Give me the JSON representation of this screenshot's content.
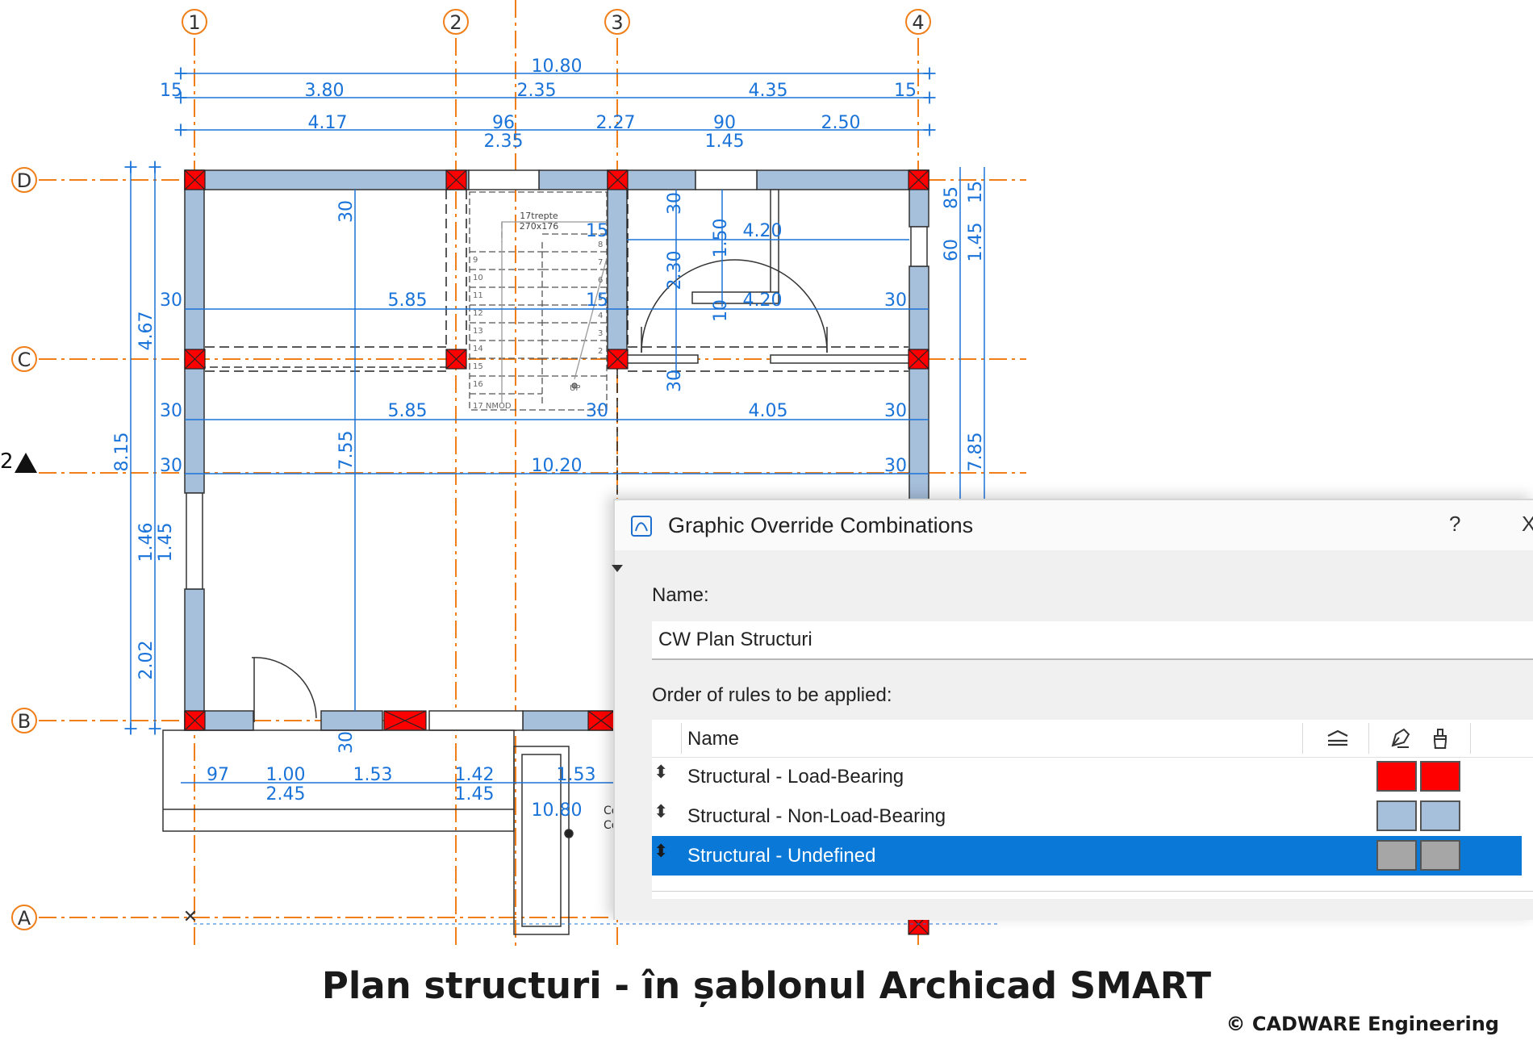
{
  "plan": {
    "grid_columns": [
      "1",
      "2",
      "3",
      "4"
    ],
    "grid_rows": [
      "D",
      "C",
      "B",
      "A"
    ],
    "section_marker": "2",
    "dims_top_total": "10.80",
    "dims_top_mid": [
      "15",
      "3.80",
      "2.35",
      "4.35",
      "15"
    ],
    "dims_top_inner": [
      "4.17",
      "96",
      "2.35",
      "2.27",
      "90",
      "1.45",
      "2.50"
    ],
    "dims_inside": [
      "30",
      "30",
      "15",
      "1.50",
      "4.20",
      "2.30",
      "30",
      "5.85",
      "15",
      "4.20",
      "10",
      "30",
      "30",
      "5.85",
      "30",
      "4.05",
      "30",
      "30",
      "7.55",
      "10.20",
      "30",
      "30",
      "30"
    ],
    "dims_left": [
      "4.67",
      "8.15",
      "1.46",
      "1.45",
      "2.02"
    ],
    "dims_right": [
      "85",
      "15",
      "60",
      "1.45",
      "7.85"
    ],
    "dims_bottom": [
      "97",
      "1.00",
      "2.45",
      "1.53",
      "1.42",
      "1.45",
      "1.53",
      "10.80"
    ],
    "stair_label_1": "17trepte",
    "stair_label_2": "270x176",
    "stair_numbers": [
      "9",
      "10",
      "11",
      "12",
      "13",
      "14",
      "15",
      "16",
      "17",
      "8",
      "7",
      "6",
      "5",
      "4",
      "3",
      "2"
    ],
    "stair_up": "UP",
    "stair_down": "17 NMOD",
    "partial_label_1": "Co",
    "partial_label_2": "Co",
    "colors": {
      "load_bearing": "#ff0000",
      "non_load_bearing": "#a6bfdb",
      "undefined": "#a6a6a6",
      "axis": "#f07f1a",
      "dimension": "#1a73d9"
    }
  },
  "dialog": {
    "title": "Graphic Override Combinations",
    "help": "?",
    "close": "X",
    "name_label": "Name:",
    "name_value": "CW Plan Structuri",
    "rules_label": "Order of rules to be applied:",
    "column_name": "Name",
    "column_icons": [
      "layers-icon",
      "pen-override-icon",
      "fill-brush-icon"
    ],
    "rules": [
      {
        "name": "Structural - Load-Bearing",
        "color1": "#ff0000",
        "color2": "#ff0000",
        "selected": false
      },
      {
        "name": "Structural - Non-Load-Bearing",
        "color1": "#a6bfdb",
        "color2": "#a6bfdb",
        "selected": false
      },
      {
        "name": "Structural - Undefined",
        "color1": "#a6a6a6",
        "color2": "#a6a6a6",
        "selected": true
      }
    ]
  },
  "caption": "Plan structuri - în șablonul Archicad SMART",
  "copyright": "© CADWARE Engineering"
}
